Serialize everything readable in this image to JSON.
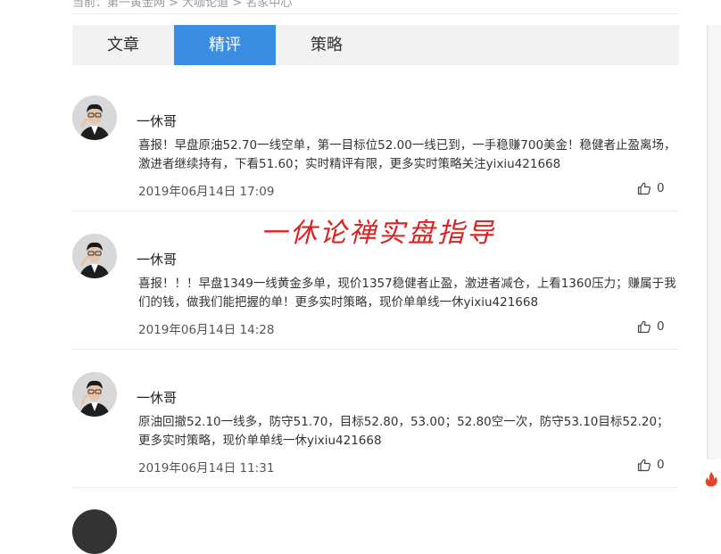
{
  "breadcrumb": "当前：第一黄金网 > 大咖论道 > 名家中心",
  "tabs": [
    {
      "label": "文章",
      "active": false
    },
    {
      "label": "精评",
      "active": true
    },
    {
      "label": "策略",
      "active": false
    }
  ],
  "watermark": "一休论禅实盘指导",
  "items": [
    {
      "name": "一休哥",
      "content": "喜报！早盘原油52.70一线空单，第一目标位52.00一线已到，一手稳赚700美金！稳健者止盈离场，激进者继续持有，下看51.60；实时精评有限，更多实时策略关注yixiu421668",
      "time": "2019年06月14日 17:09",
      "likes": "0"
    },
    {
      "name": "一休哥",
      "content": "喜报！！！早盘1349一线黄金多单，现价1357稳健者止盈，激进者减仓，上看1360压力；赚属于我们的钱，做我们能把握的单！更多实时策略，现价单单线一休yixiu421668",
      "time": "2019年06月14日 14:28",
      "likes": "0"
    },
    {
      "name": "一休哥",
      "content": "原油回撤52.10一线多，防守51.70，目标52.80，53.00；52.80空一次，防守53.10目标52.20；更多实时策略，现价单单线一休yixiu421668",
      "time": "2019年06月14日 11:31",
      "likes": "0"
    }
  ],
  "colors": {
    "tab_active": "#3a8de2",
    "watermark": "#e02020"
  }
}
